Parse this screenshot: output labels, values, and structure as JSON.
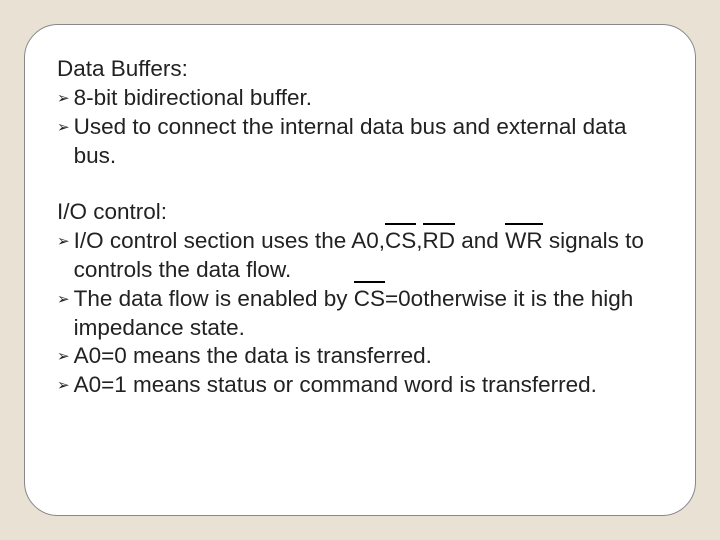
{
  "section1": {
    "heading": "Data Buffers:",
    "bullets": [
      "8-bit bidirectional buffer.",
      "Used to connect the internal data bus and external data bus."
    ]
  },
  "section2": {
    "heading": "I/O control:",
    "b1_pre": "I/O control section uses the A0,",
    "cs": "CS",
    "comma": ",",
    "rd": "RD",
    "b1_mid": " and ",
    "wr": "WR",
    "b1_post": " signals to controls the data flow.",
    "b2_pre": "The data flow is enabled by ",
    "b2_post": "=0otherwise it is the high impedance state.",
    "b3": "A0=0 means the data is transferred.",
    "b4": "A0=1 means status or command word is transferred."
  }
}
